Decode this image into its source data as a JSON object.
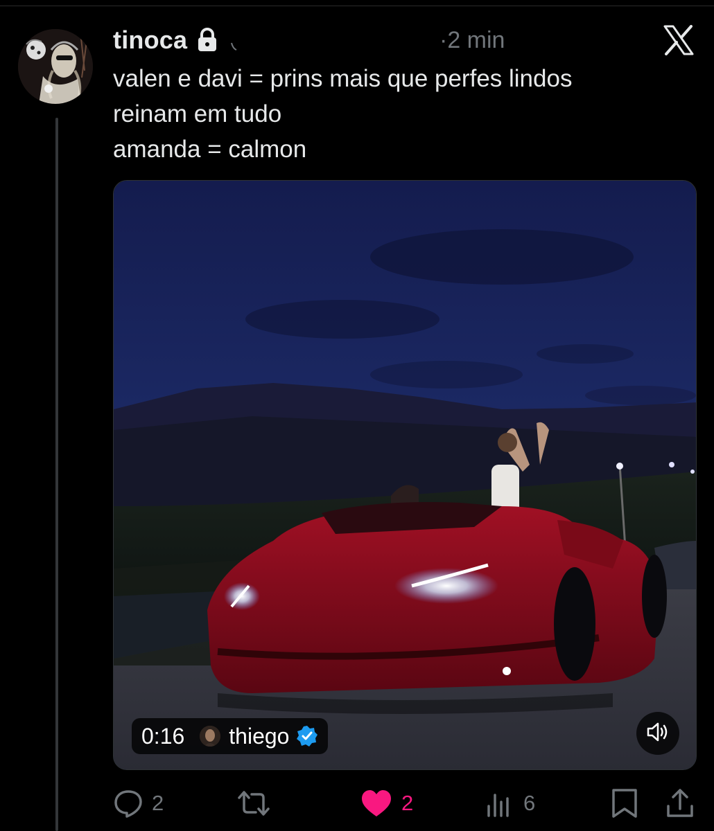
{
  "post": {
    "username": "tinoca",
    "time": "·2 min",
    "lines": [
      "valen e davi = prins mais que perfes lindos",
      "reinam em tudo",
      "amanda = calmon"
    ]
  },
  "media": {
    "duration": "0:16",
    "creator": "thiego",
    "creator_verified": true
  },
  "actions": {
    "replies": "2",
    "reposts": "",
    "likes": "2",
    "liked": true,
    "views": "6"
  },
  "icons": {
    "lock": "lock-icon",
    "brand": "x-logo-icon",
    "reply": "reply-icon",
    "repost": "repost-icon",
    "like": "heart-icon",
    "views": "views-icon",
    "bookmark": "bookmark-icon",
    "share": "share-icon",
    "sound": "speaker-icon",
    "verified": "verified-badge-icon"
  },
  "colors": {
    "background": "#000000",
    "text": "#e7e9ea",
    "muted": "#71767b",
    "like": "#f91880",
    "verified": "#1d9bf0"
  }
}
